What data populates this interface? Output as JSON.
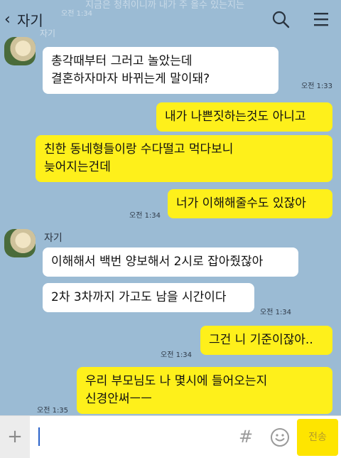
{
  "header": {
    "back_icon": "chevron-left-icon",
    "title": "자기",
    "search_icon": "search-icon",
    "menu_icon": "hamburger-menu-icon",
    "faded_top_text": "지금은 청취이니까 내가 주 올수 있는지는",
    "faded_name": "자기",
    "faded_time": "오전 1:34"
  },
  "messages": [
    {
      "side": "in",
      "text": "총각때부터 그러고 놀았는데\n결혼하자마자 바뀌는게 말이돼?",
      "time": "오전 1:33"
    },
    {
      "side": "out",
      "text": "내가 나쁜짓하는것도 아니고",
      "time": ""
    },
    {
      "side": "out",
      "text": "친한 동네형들이랑 수다떨고 먹다보니\n늦어지는건데",
      "time": ""
    },
    {
      "side": "out",
      "text": "너가 이해해줄수도 있잖아",
      "time": "오전 1:34"
    },
    {
      "side": "in",
      "sender": "자기",
      "text": "이해해서 백번 양보해서 2시로 잡아줬잖아",
      "time": ""
    },
    {
      "side": "in",
      "text": "2차 3차까지 가고도 남을 시간이다",
      "time": "오전 1:34"
    },
    {
      "side": "out",
      "text": "그건 니 기준이잖아..",
      "time": "오전 1:34"
    },
    {
      "side": "out",
      "text": "우리 부모님도 나 몇시에 들어오는지\n신경안써ㅡㅡ",
      "time": "오전 1:35"
    }
  ],
  "input_bar": {
    "plus_label": "+",
    "placeholder": "",
    "hash_label": "#",
    "emoji_icon": "smile-icon",
    "send_label": "전송"
  },
  "colors": {
    "background": "#9bbbd4",
    "incoming_bubble": "#ffffff",
    "outgoing_bubble": "#fef01b",
    "send_button": "#fee500"
  }
}
